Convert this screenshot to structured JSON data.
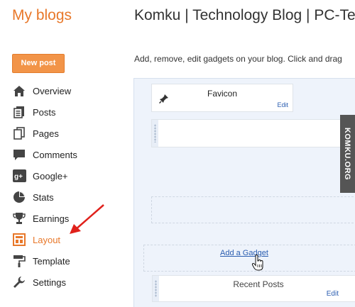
{
  "header": {
    "brand": "My blogs",
    "blog_title": "Komku | Technology Blog | PC-Te"
  },
  "sidebar": {
    "new_post_label": "New post",
    "items": [
      {
        "label": "Overview",
        "icon": "home-icon"
      },
      {
        "label": "Posts",
        "icon": "posts-icon"
      },
      {
        "label": "Pages",
        "icon": "pages-icon"
      },
      {
        "label": "Comments",
        "icon": "comment-icon"
      },
      {
        "label": "Google+",
        "icon": "google-plus-icon"
      },
      {
        "label": "Stats",
        "icon": "pie-chart-icon"
      },
      {
        "label": "Earnings",
        "icon": "trophy-icon"
      },
      {
        "label": "Layout",
        "icon": "layout-icon",
        "active": true
      },
      {
        "label": "Template",
        "icon": "paint-roller-icon"
      },
      {
        "label": "Settings",
        "icon": "wrench-icon"
      }
    ]
  },
  "main": {
    "description": "Add, remove, edit gadgets on your blog. Click and drag"
  },
  "gadgets": {
    "favicon": {
      "title": "Favicon",
      "edit": "Edit"
    },
    "add_gadget": "Add a Gadget",
    "recent_posts": {
      "title": "Recent Posts",
      "edit": "Edit"
    }
  },
  "watermark": "KOMKU.ORG",
  "colors": {
    "accent": "#e8782a",
    "button": "#f29448",
    "link": "#2a5db0",
    "arrow": "#e0211b"
  }
}
